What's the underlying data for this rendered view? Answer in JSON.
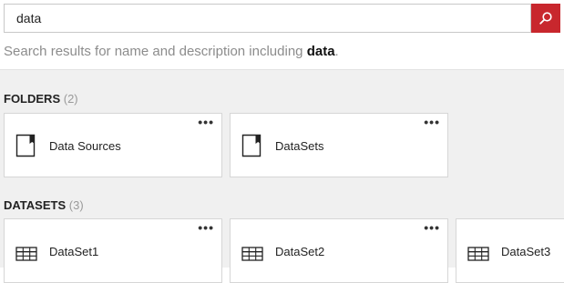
{
  "search": {
    "value": "data",
    "hint_prefix": "Search results for name and description including ",
    "hint_term": "data",
    "hint_suffix": "."
  },
  "folders": {
    "title": "FOLDERS",
    "count": "(2)",
    "items": [
      {
        "label": "Data Sources",
        "icon": "folder-icon"
      },
      {
        "label": "DataSets",
        "icon": "folder-icon"
      }
    ]
  },
  "datasets": {
    "title": "DATASETS",
    "count": "(3)",
    "items": [
      {
        "label": "DataSet1",
        "icon": "table-icon"
      },
      {
        "label": "DataSet2",
        "icon": "table-icon"
      },
      {
        "label": "DataSet3",
        "icon": "table-icon"
      }
    ]
  },
  "more_label": "•••",
  "colors": {
    "accent": "#c8272d",
    "background": "#f0f0f0"
  }
}
